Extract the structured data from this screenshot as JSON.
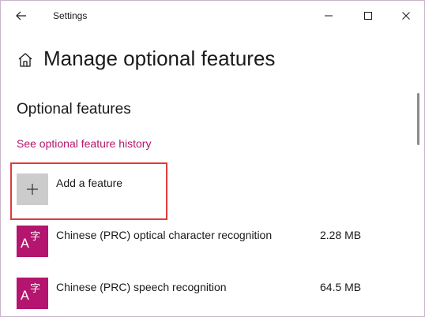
{
  "window": {
    "title": "Settings"
  },
  "header": {
    "page_title": "Manage optional features"
  },
  "section": {
    "title": "Optional features",
    "history_link": "See optional feature history"
  },
  "add_feature": {
    "label": "Add a feature",
    "icon": "plus-icon"
  },
  "features": [
    {
      "name": "Chinese (PRC) optical character recognition",
      "size": "2.28 MB",
      "icon": "language-icon",
      "icon_a": "A",
      "icon_zi": "字"
    },
    {
      "name": "Chinese (PRC) speech recognition",
      "size": "64.5 MB",
      "icon": "language-icon",
      "icon_a": "A",
      "icon_zi": "字"
    }
  ],
  "colors": {
    "accent": "#b4156e",
    "highlight_border": "#e03b3b",
    "add_tile": "#cccccc"
  }
}
